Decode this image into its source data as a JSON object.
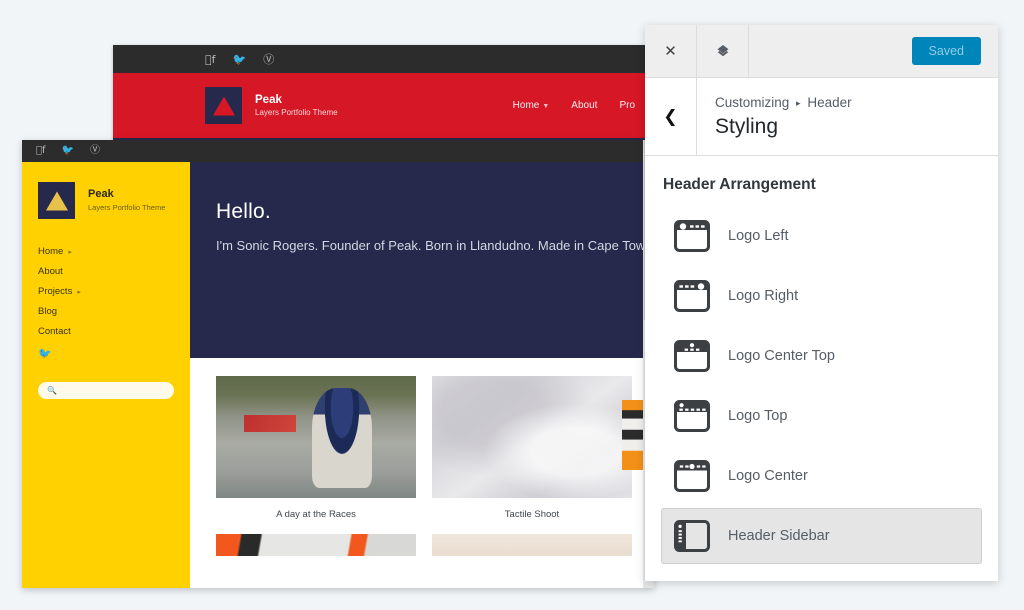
{
  "preview_back": {
    "social_icons": [
      "facebook-icon",
      "twitter-icon",
      "vimeo-icon"
    ],
    "brand_name": "Peak",
    "brand_tagline": "Layers Portfolio Theme",
    "nav": [
      "Home",
      "About",
      "Pro"
    ]
  },
  "preview_front": {
    "social_icons": [
      "facebook-icon",
      "twitter-icon",
      "vimeo-icon"
    ],
    "brand_name": "Peak",
    "brand_tagline": "Layers Portfolio Theme",
    "nav": [
      {
        "label": "Home",
        "has_submenu": true
      },
      {
        "label": "About",
        "has_submenu": false
      },
      {
        "label": "Projects",
        "has_submenu": true
      },
      {
        "label": "Blog",
        "has_submenu": false
      },
      {
        "label": "Contact",
        "has_submenu": false
      }
    ],
    "twitter_icon": "twitter-icon",
    "search_placeholder": "",
    "hero": {
      "heading": "Hello.",
      "body": "I'm Sonic Rogers. Founder of Peak. Born in Llandudno. Made in Cape Town. Veteran of all things digital. Builder of brand experiences & Former Stunt Driver and avid sneaker collector."
    },
    "gallery": [
      {
        "caption": "A day at the Races"
      },
      {
        "caption": "Tactile Shoot"
      }
    ]
  },
  "customizer": {
    "close_icon": "close-icon",
    "collapse_icon": "collapse-chevrons-icon",
    "save_label": "Saved",
    "back_icon": "chevron-left-icon",
    "breadcrumb_root": "Customizing",
    "breadcrumb_separator": "▸",
    "breadcrumb_current": "Header",
    "panel_title": "Styling",
    "section_title": "Header Arrangement",
    "arrangements": [
      {
        "label": "Logo Left",
        "icon": "layout-logo-left-icon",
        "selected": false
      },
      {
        "label": "Logo Right",
        "icon": "layout-logo-right-icon",
        "selected": false
      },
      {
        "label": "Logo Center Top",
        "icon": "layout-logo-center-top-icon",
        "selected": false
      },
      {
        "label": "Logo Top",
        "icon": "layout-logo-top-icon",
        "selected": false
      },
      {
        "label": "Logo Center",
        "icon": "layout-logo-center-icon",
        "selected": false
      },
      {
        "label": "Header Sidebar",
        "icon": "layout-header-sidebar-icon",
        "selected": true
      }
    ]
  },
  "colors": {
    "accent_blue": "#0085ba",
    "brand_red": "#d61726",
    "brand_yellow": "#ffd100",
    "navy": "#26294b",
    "page_bg": "#f1f5f8"
  }
}
